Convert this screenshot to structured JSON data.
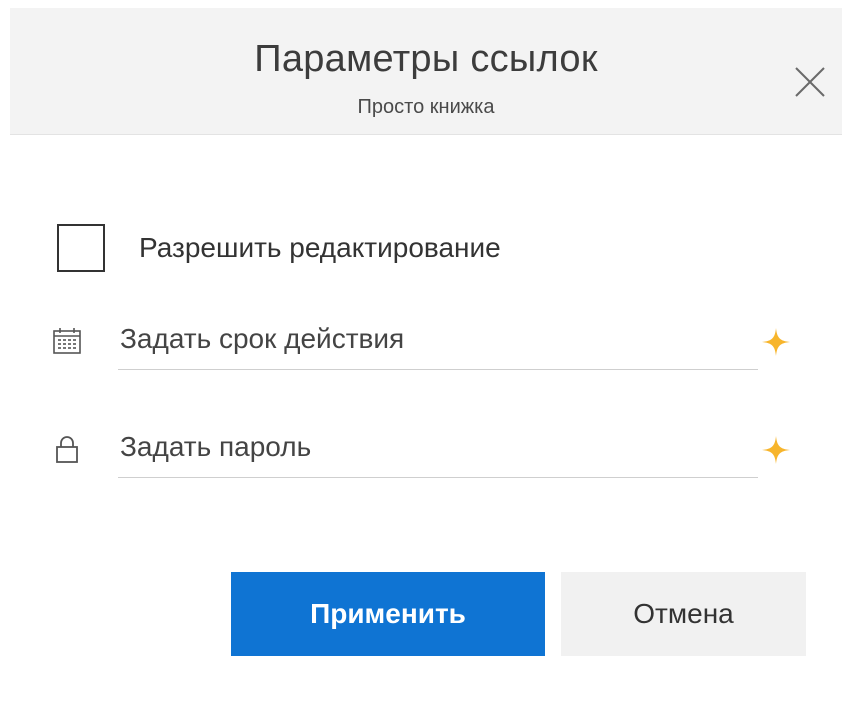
{
  "header": {
    "title": "Параметры ссылок",
    "subtitle": "Просто книжка",
    "close_icon": "close-icon"
  },
  "options": {
    "allow_editing": {
      "label": "Разрешить редактирование",
      "checked": false
    },
    "expiry": {
      "placeholder": "Задать срок действия",
      "value": "",
      "icon": "calendar-icon",
      "badge_icon": "premium-sparkle-icon"
    },
    "password": {
      "placeholder": "Задать пароль",
      "value": "",
      "icon": "lock-icon",
      "badge_icon": "premium-sparkle-icon"
    }
  },
  "buttons": {
    "apply": "Применить",
    "cancel": "Отмена"
  },
  "colors": {
    "primary": "#0f74d3",
    "header_bg": "#f3f3f3",
    "premium": "#f7b52c",
    "secondary_button": "#f1f1f1"
  }
}
